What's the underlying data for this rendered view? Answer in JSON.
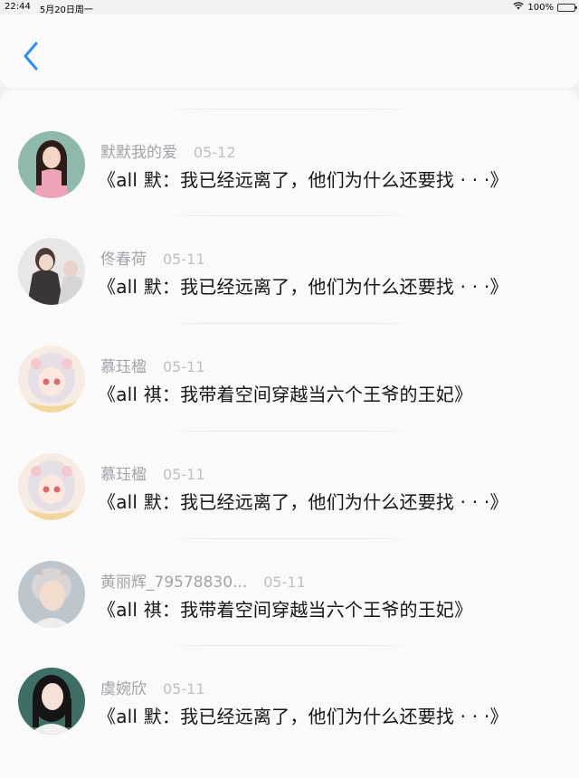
{
  "status_bar": {
    "time": "22:44",
    "date": "5月20日周一",
    "battery": "100%",
    "battery_level": 1.0
  },
  "nav": {
    "back_icon": "chevron-left-icon",
    "accent_color": "#2f8cff"
  },
  "comments": [
    {
      "username": "默默我的爱",
      "date": "05-12",
      "title": "《all 默：我已经远离了，他们为什么还要找 · · ·》"
    },
    {
      "username": "佟春荷",
      "date": "05-11",
      "title": "《all 默：我已经远离了，他们为什么还要找 · · ·》"
    },
    {
      "username": "慕珏楹",
      "date": "05-11",
      "title": "《all 祺：我带着空间穿越当六个王爷的王妃》"
    },
    {
      "username": "慕珏楹",
      "date": "05-11",
      "title": "《all 默：我已经远离了，他们为什么还要找 · · ·》"
    },
    {
      "username": "黄丽辉_79578830...",
      "date": "05-11",
      "title": "《all 祺：我带着空间穿越当六个王爷的王妃》"
    },
    {
      "username": "虞婉欣",
      "date": "05-11",
      "title": "《all 默：我已经远离了，他们为什么还要找 · · ·》"
    }
  ]
}
